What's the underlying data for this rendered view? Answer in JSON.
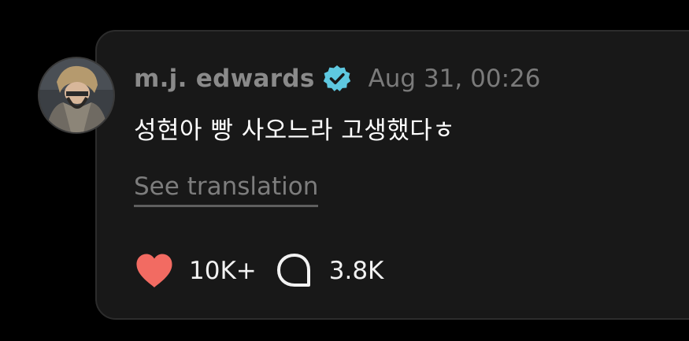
{
  "post": {
    "username": "m.j. edwards",
    "verified": true,
    "timestamp": "Aug 31, 00:26",
    "message": "성현아 빵 사오느라 고생했다ㅎ",
    "see_translation_label": "See translation",
    "likes_count": "10K+",
    "replies_count": "3.8K"
  },
  "icons": {
    "avatar": "avatar-photo",
    "verified": "verified-badge-icon",
    "like": "heart-icon",
    "reply": "speech-bubble-icon"
  },
  "colors": {
    "background": "#000000",
    "card": "#181818",
    "card_border": "#2c2c2c",
    "username": "#8a8a8a",
    "timestamp": "#7a7a7a",
    "message": "#ffffff",
    "link": "#7d7d7d",
    "verified_badge": "#5ec8e0",
    "heart": "#f26b62"
  }
}
